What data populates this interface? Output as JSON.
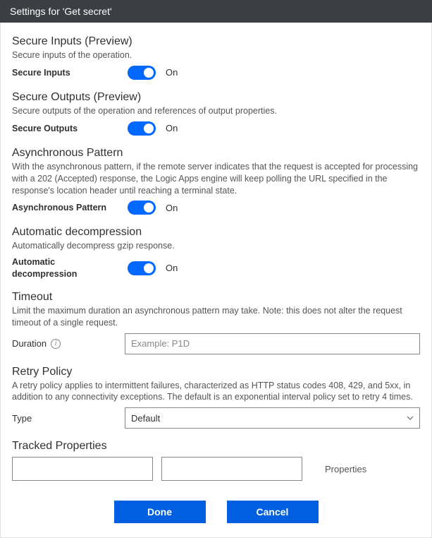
{
  "titlebar": "Settings for 'Get secret'",
  "sections": {
    "secureInputs": {
      "title": "Secure Inputs (Preview)",
      "desc": "Secure inputs of the operation.",
      "label": "Secure Inputs",
      "state": "On"
    },
    "secureOutputs": {
      "title": "Secure Outputs (Preview)",
      "desc": "Secure outputs of the operation and references of output properties.",
      "label": "Secure Outputs",
      "state": "On"
    },
    "asyncPattern": {
      "title": "Asynchronous Pattern",
      "desc": "With the asynchronous pattern, if the remote server indicates that the request is accepted for processing with a 202 (Accepted) response, the Logic Apps engine will keep polling the URL specified in the response's location header until reaching a terminal state.",
      "label": "Asynchronous Pattern",
      "state": "On"
    },
    "autoDecomp": {
      "title": "Automatic decompression",
      "desc": "Automatically decompress gzip response.",
      "label": "Automatic decompression",
      "state": "On"
    },
    "timeout": {
      "title": "Timeout",
      "desc": "Limit the maximum duration an asynchronous pattern may take. Note: this does not alter the request timeout of a single request.",
      "label": "Duration",
      "placeholder": "Example: P1D"
    },
    "retry": {
      "title": "Retry Policy",
      "desc": "A retry policy applies to intermittent failures, characterized as HTTP status codes 408, 429, and 5xx, in addition to any connectivity exceptions. The default is an exponential interval policy set to retry 4 times.",
      "label": "Type",
      "value": "Default"
    },
    "tracked": {
      "title": "Tracked Properties",
      "propLabel": "Properties"
    }
  },
  "buttons": {
    "done": "Done",
    "cancel": "Cancel"
  }
}
